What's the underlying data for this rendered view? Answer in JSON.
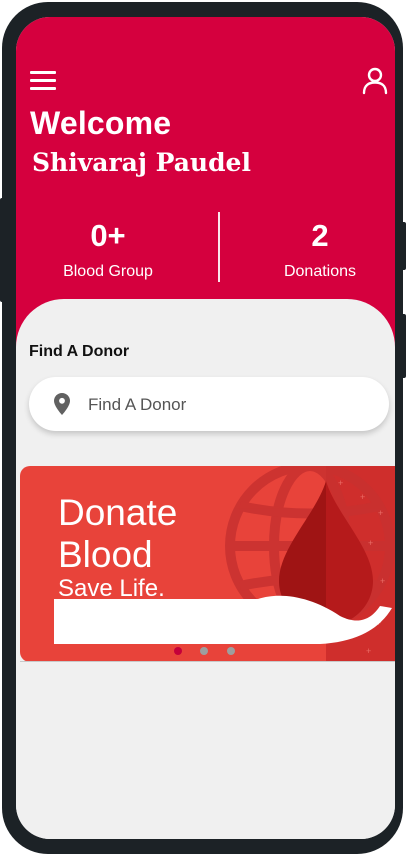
{
  "header": {
    "greeting": "Welcome",
    "user_name": "Shivaraj Paudel",
    "menu_icon": "menu-icon",
    "profile_icon": "user-icon"
  },
  "stats": {
    "blood_group": {
      "value": "0+",
      "label": "Blood Group"
    },
    "donations": {
      "value": "2",
      "label": "Donations"
    }
  },
  "search": {
    "section_title": "Find A Donor",
    "placeholder": "Find A Donor",
    "value": "",
    "icon": "location-pin-icon"
  },
  "banner": {
    "line1": "Donate",
    "line2": "Blood",
    "line3": "Save Life.",
    "slide_count": 3,
    "active_slide": 1
  },
  "colors": {
    "primary": "#d5003e",
    "banner": "#e8433a",
    "background": "#f0f0f0",
    "frame": "#1c2226"
  }
}
